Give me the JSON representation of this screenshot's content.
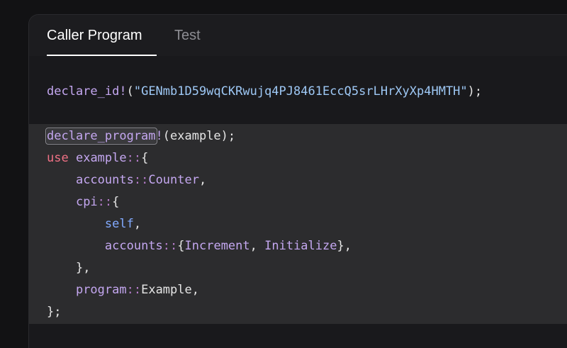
{
  "tabs": {
    "caller": "Caller Program",
    "test": "Test"
  },
  "code": {
    "l1": {
      "mac": "declare_id!",
      "open": "(",
      "str": "\"GENmb1D59wqCKRwujq4PJ8461EccQ5srLHrXyXp4HMTH\"",
      "close": ");"
    },
    "l2": {
      "mac": "declare_program",
      "bang": "!",
      "rest": "(example);"
    },
    "l3": {
      "kw": "use",
      "sp": " ",
      "id": "example",
      "sep": "::",
      "rest": "{"
    },
    "l4": {
      "indent": "    ",
      "id": "accounts",
      "sep": "::",
      "id2": "Counter",
      "rest": ","
    },
    "l5": {
      "indent": "    ",
      "id": "cpi",
      "sep": "::",
      "rest": "{"
    },
    "l6": {
      "indent": "        ",
      "slf": "self",
      "rest": ","
    },
    "l7": {
      "indent": "        ",
      "id": "accounts",
      "sep": "::",
      "open": "{",
      "id2": "Increment",
      "comma": ", ",
      "id3": "Initialize",
      "close": "},"
    },
    "l8": {
      "indent": "    ",
      "rest": "},"
    },
    "l9": {
      "indent": "    ",
      "id": "program",
      "sep": "::",
      "id2": "Example",
      "rest": ","
    },
    "l10": {
      "rest": "};"
    }
  },
  "colors": {
    "background": "#121214",
    "panel": "#1c1c1f",
    "highlight": "#2c2c2e",
    "macro": "#c4a7f0",
    "string": "#9ec8f5",
    "keyword": "#f07185"
  }
}
